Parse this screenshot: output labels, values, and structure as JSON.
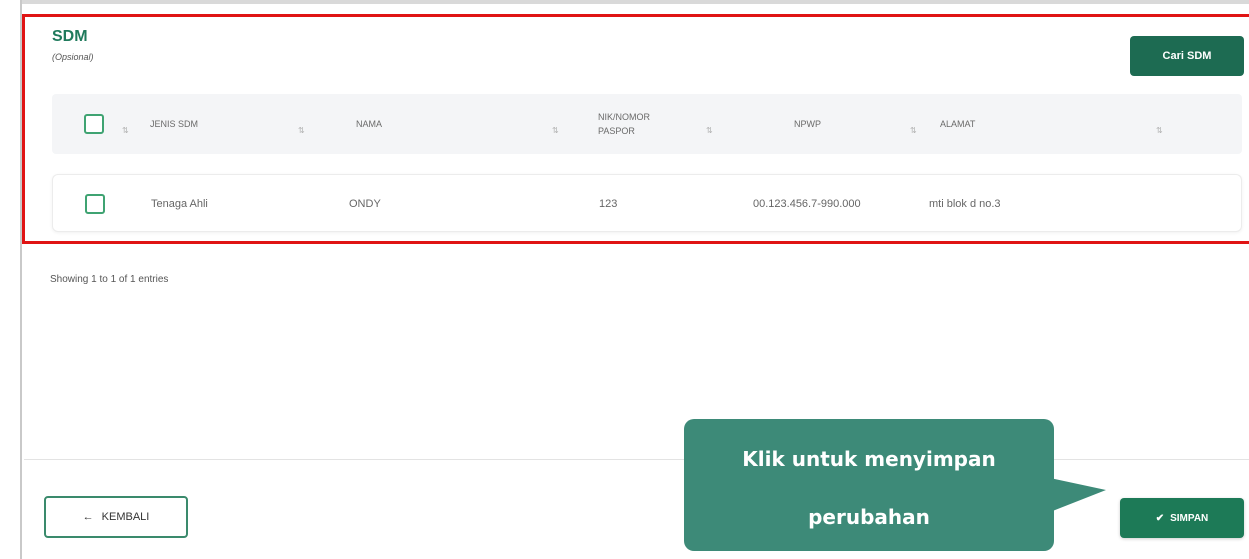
{
  "section": {
    "title": "SDM",
    "subtitle": "(Opsional)",
    "search_button": "Cari SDM"
  },
  "table": {
    "columns": [
      {
        "key": "jenis",
        "label": "JENIS SDM"
      },
      {
        "key": "nama",
        "label": "NAMA"
      },
      {
        "key": "nik",
        "label": "NIK/NOMOR PASPOR"
      },
      {
        "key": "npwp",
        "label": "NPWP"
      },
      {
        "key": "alamat",
        "label": "ALAMAT"
      }
    ],
    "rows": [
      {
        "jenis": "Tenaga Ahli",
        "nama": "ONDY",
        "nik": "123",
        "npwp": "00.123.456.7-990.000",
        "alamat": "mti blok d no.3"
      }
    ],
    "sort_icon": "sort-arrows-icon",
    "info": "Showing 1 to 1 of 1 entries"
  },
  "footer": {
    "back_button": "KEMBALI",
    "save_button": "SIMPAN",
    "back_icon": "←",
    "save_icon": "✔"
  },
  "tooltip": {
    "line1": "Klik untuk menyimpan",
    "line2": "perubahan"
  },
  "colors": {
    "primary": "#1d6b52",
    "highlight": "#e01414",
    "tooltip": "#3d8a78"
  }
}
